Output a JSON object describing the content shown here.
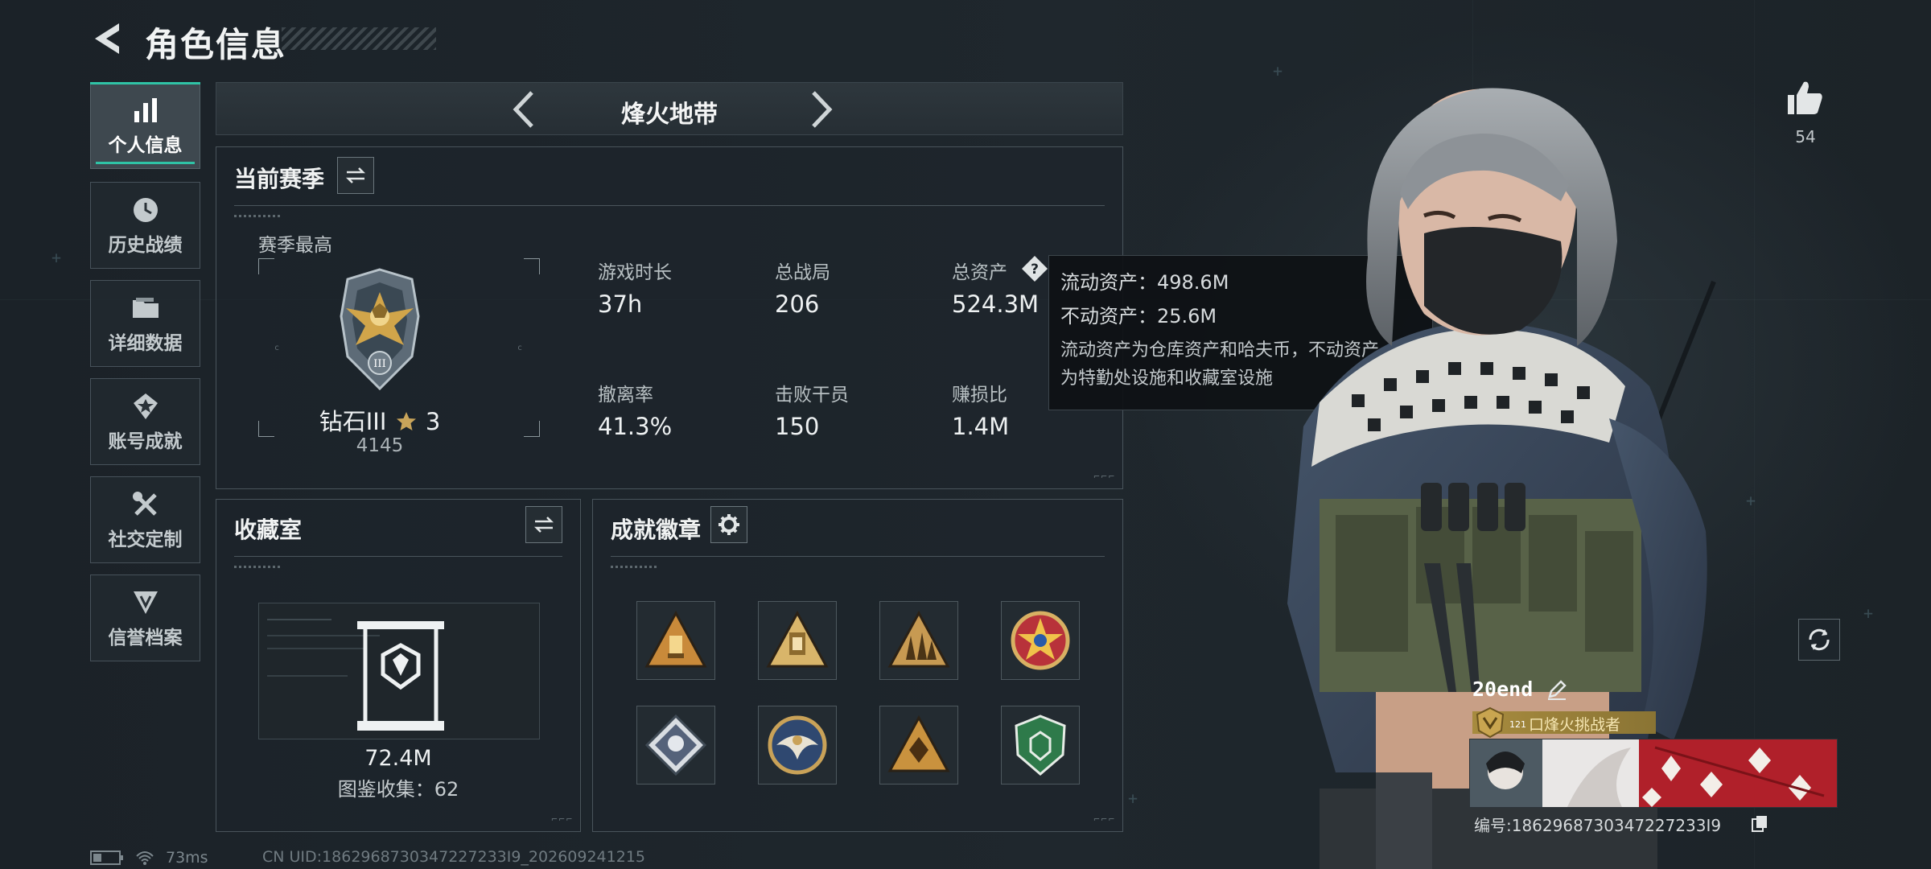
{
  "header": {
    "title": "角色信息"
  },
  "sidebar": {
    "items": [
      {
        "label": "个人信息",
        "icon": "bar-chart-icon",
        "active": true
      },
      {
        "label": "历史战绩",
        "icon": "clock-icon",
        "active": false
      },
      {
        "label": "详细数据",
        "icon": "folder-icon",
        "active": false
      },
      {
        "label": "账号成就",
        "icon": "achievement-icon",
        "active": false
      },
      {
        "label": "社交定制",
        "icon": "tools-icon",
        "active": false
      },
      {
        "label": "信誉档案",
        "icon": "credit-icon",
        "active": false
      }
    ]
  },
  "mode": {
    "name": "烽火地带"
  },
  "season": {
    "title": "当前赛季",
    "best_label": "赛季最高",
    "rank_name": "钻石III",
    "rank_stars": "3",
    "rank_points": "4145",
    "stats": [
      {
        "label": "游戏时长",
        "value": "37h"
      },
      {
        "label": "总战局",
        "value": "206"
      },
      {
        "label": "总资产",
        "value": "524.3M"
      },
      {
        "label": "撤离率",
        "value": "41.3%"
      },
      {
        "label": "击败干员",
        "value": "150"
      },
      {
        "label": "赚损比",
        "value": "1.4M"
      }
    ],
    "help_glyph": "?"
  },
  "tooltip": {
    "liquid": "流动资产：498.6M",
    "fixed": "不动资产：25.6M",
    "desc_line1": "流动资产为仓库资产和哈夫币，不动资产",
    "desc_line2": "为特勤处设施和收藏室设施"
  },
  "collection": {
    "title": "收藏室",
    "value": "72.4M",
    "count_label": "图鉴收集：62"
  },
  "badges": {
    "title": "成就徽章",
    "items": [
      "gold-triangle-badge-icon",
      "temple-triangle-badge-icon",
      "soldiers-triangle-badge-icon",
      "red-star-medal-icon",
      "diamond-rose-badge-icon",
      "eagle-coin-badge-icon",
      "gold-diamond-triangle-badge-icon",
      "green-shield-badge-icon"
    ]
  },
  "social": {
    "likes": "54"
  },
  "player": {
    "name": "20end",
    "tag": "口烽火挑战者",
    "level": "121",
    "id": "编号:1862968730347227233I9"
  },
  "status": {
    "ping": "73ms",
    "uid": "CN UID:1862968730347227233I9_202609241215"
  },
  "colors": {
    "accent": "#2fc3a6",
    "background": "#1a2127",
    "gold": "#c8a45a"
  }
}
